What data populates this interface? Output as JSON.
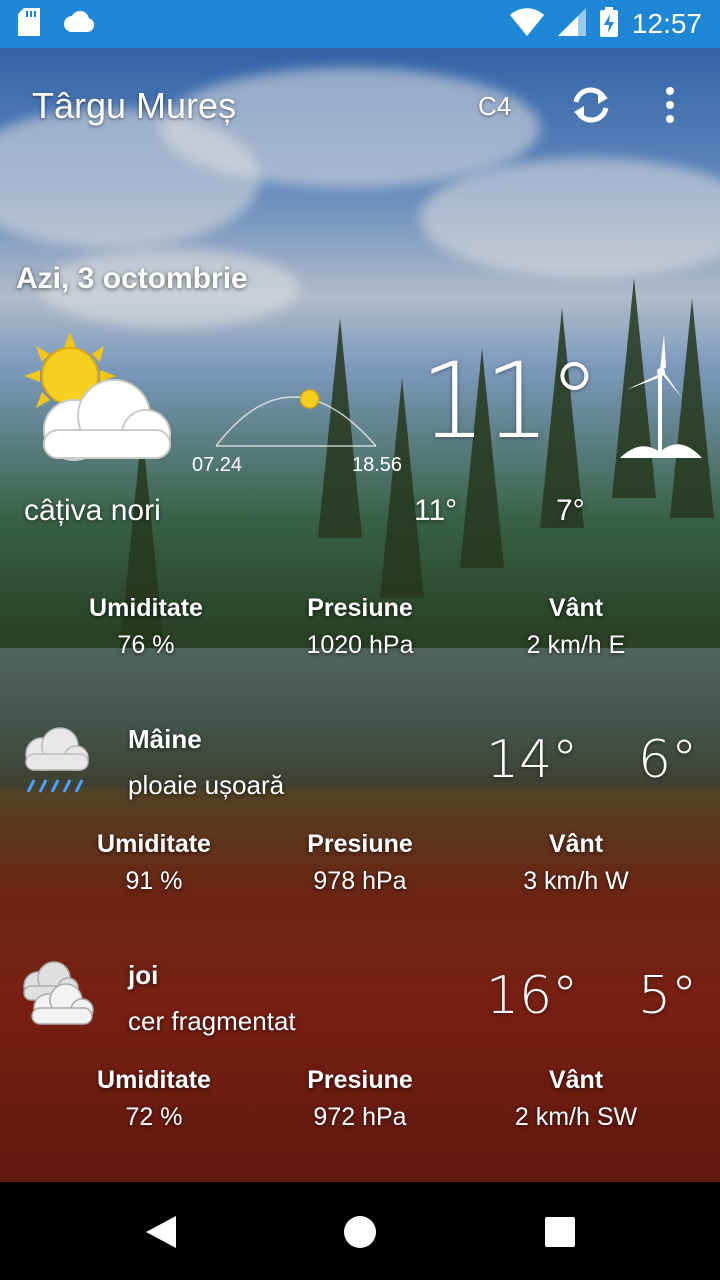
{
  "status_bar": {
    "time": "12:57",
    "icons": [
      "sd-card-icon",
      "cloud-icon",
      "wifi-icon",
      "cellular-signal-icon",
      "battery-charging-icon"
    ]
  },
  "toolbar": {
    "city": "Târgu Mureș",
    "units_label": "C4",
    "refresh_icon": "refresh-icon",
    "menu_icon": "more-vert-icon"
  },
  "today": {
    "date": "Azi, 3 octombrie",
    "icon": "partly-cloudy-icon",
    "sunrise": "07.24",
    "sunset": "18.56",
    "sun_progress": 0.6,
    "temperature": "11°",
    "condition": "câțiva nori",
    "max": "11°",
    "min": "7°",
    "stats": [
      {
        "label": "Umiditate",
        "value": "76 %"
      },
      {
        "label": "Presiune",
        "value": "1020 hPa"
      },
      {
        "label": "Vânt",
        "value": "2 km/h E"
      }
    ]
  },
  "forecast": [
    {
      "name": "Mâine",
      "description": "ploaie ușoară",
      "icon": "light-rain-icon",
      "max": "14°",
      "min": "6°",
      "stats": [
        {
          "label": "Umiditate",
          "value": "91 %"
        },
        {
          "label": "Presiune",
          "value": "978 hPa"
        },
        {
          "label": "Vânt",
          "value": "3 km/h W"
        }
      ]
    },
    {
      "name": "joi",
      "description": "cer fragmentat",
      "icon": "broken-clouds-icon",
      "max": "16°",
      "min": "5°",
      "stats": [
        {
          "label": "Umiditate",
          "value": "72 %"
        },
        {
          "label": "Presiune",
          "value": "972 hPa"
        },
        {
          "label": "Vânt",
          "value": "2 km/h SW"
        }
      ]
    }
  ],
  "colors": {
    "status_bar": "#1e88d6",
    "text": "#ffffff",
    "sun": "#f5d020"
  }
}
